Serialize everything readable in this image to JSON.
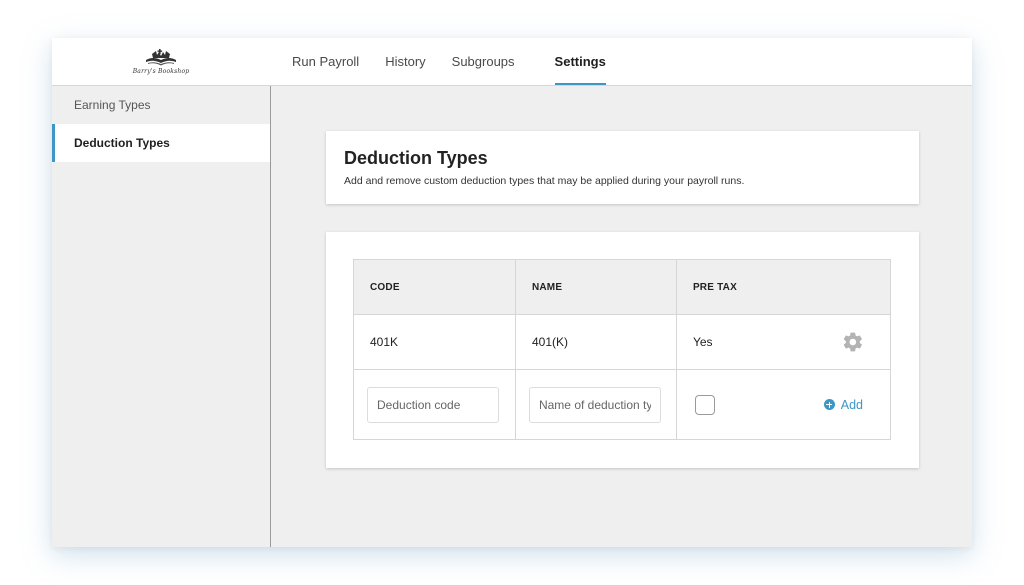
{
  "brand": {
    "logo_text": "Barry's Bookshop"
  },
  "nav": {
    "tabs": [
      {
        "label": "Run Payroll"
      },
      {
        "label": "History"
      },
      {
        "label": "Subgroups"
      },
      {
        "label": "Settings",
        "active": true
      }
    ]
  },
  "sidebar": {
    "items": [
      {
        "label": "Earning Types"
      },
      {
        "label": "Deduction Types",
        "active": true
      }
    ]
  },
  "header_card": {
    "title": "Deduction Types",
    "subtitle": "Add and remove custom deduction types that may be applied during your payroll runs."
  },
  "table": {
    "columns": [
      "CODE",
      "NAME",
      "PRE TAX"
    ],
    "rows": [
      {
        "code": "401K",
        "name": "401(K)",
        "pre_tax": "Yes",
        "action_icon": "gear-icon"
      }
    ],
    "new_row": {
      "code_placeholder": "Deduction code",
      "name_placeholder": "Name of deduction type",
      "pre_tax_checked": false,
      "add_label": "Add",
      "add_icon": "plus-circle-icon"
    }
  },
  "colors": {
    "accent": "#3d97c4",
    "background": "#efefef",
    "card": "#ffffff"
  }
}
